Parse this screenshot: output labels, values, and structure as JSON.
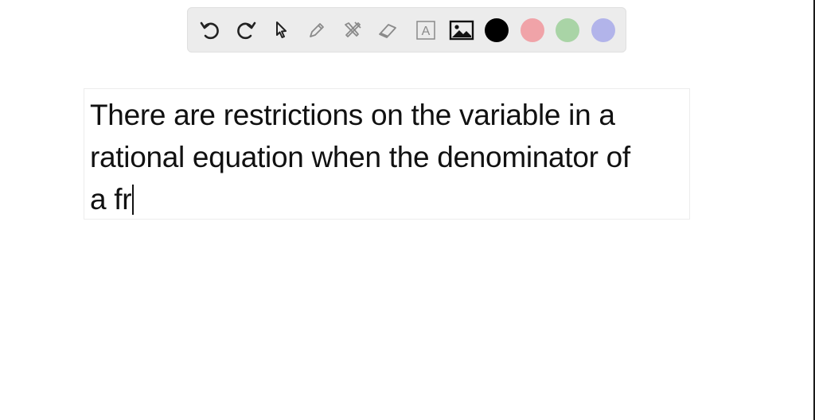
{
  "toolbar": {
    "tools": [
      {
        "name": "undo-icon",
        "enabled": true
      },
      {
        "name": "redo-icon",
        "enabled": true
      },
      {
        "name": "select-pointer-icon",
        "enabled": true
      },
      {
        "name": "pen-icon",
        "enabled": false
      },
      {
        "name": "tools-icon",
        "enabled": false
      },
      {
        "name": "eraser-icon",
        "enabled": false
      },
      {
        "name": "text-tool-icon",
        "enabled": false
      },
      {
        "name": "image-icon",
        "enabled": true
      }
    ],
    "text_tool_glyph": "A",
    "colors": [
      "#000000",
      "#f0a3a8",
      "#a9d4a6",
      "#b2b4ea"
    ],
    "selected_color": "#000000"
  },
  "text_box": {
    "lines": [
      "There are restrictions on the variable in a",
      "rational equation when the denominator of",
      "a fr"
    ]
  }
}
